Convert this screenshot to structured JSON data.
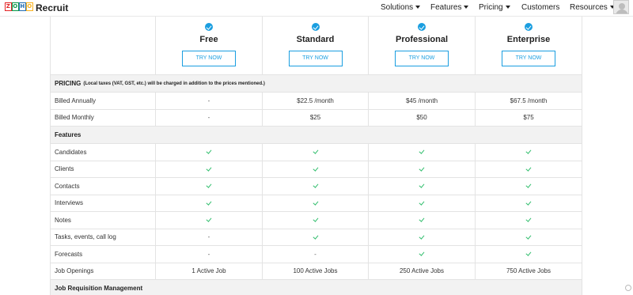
{
  "header": {
    "logo_letters": [
      "Z",
      "O",
      "H",
      "O"
    ],
    "logo_colors": [
      "#e42527",
      "#089949",
      "#226db4",
      "#f9b21d"
    ],
    "brand": "Recruit",
    "nav": [
      {
        "label": "Solutions",
        "has_caret": true
      },
      {
        "label": "Features",
        "has_caret": true
      },
      {
        "label": "Pricing",
        "has_caret": true
      },
      {
        "label": "Customers",
        "has_caret": false
      },
      {
        "label": "Resources",
        "has_caret": true
      }
    ]
  },
  "plans": [
    {
      "name": "Free",
      "cta": "TRY NOW"
    },
    {
      "name": "Standard",
      "cta": "TRY NOW"
    },
    {
      "name": "Professional",
      "cta": "TRY NOW"
    },
    {
      "name": "Enterprise",
      "cta": "TRY NOW"
    }
  ],
  "pricing_section": {
    "title": "PRICING",
    "note": "(Local taxes (VAT, GST, etc.) will be charged in addition to the prices mentioned.)"
  },
  "pricing_rows": [
    {
      "label": "Billed Annually",
      "values": [
        "-",
        "$22.5 /month",
        "$45 /month",
        "$67.5 /month"
      ]
    },
    {
      "label": "Billed Monthly",
      "values": [
        "-",
        "$25",
        "$50",
        "$75"
      ]
    }
  ],
  "features_section": {
    "title": "Features"
  },
  "feature_rows": [
    {
      "label": "Candidates",
      "values": [
        "check",
        "check",
        "check",
        "check"
      ]
    },
    {
      "label": "Clients",
      "values": [
        "check",
        "check",
        "check",
        "check"
      ]
    },
    {
      "label": "Contacts",
      "values": [
        "check",
        "check",
        "check",
        "check"
      ]
    },
    {
      "label": "Interviews",
      "values": [
        "check",
        "check",
        "check",
        "check"
      ]
    },
    {
      "label": "Notes",
      "values": [
        "check",
        "check",
        "check",
        "check"
      ]
    },
    {
      "label": "Tasks, events, call log",
      "values": [
        "-",
        "check",
        "check",
        "check"
      ]
    },
    {
      "label": "Forecasts",
      "values": [
        "-",
        "-",
        "check",
        "check"
      ]
    },
    {
      "label": "Job Openings",
      "values": [
        "1 Active Job",
        "100 Active Jobs",
        "250 Active Jobs",
        "750 Active Jobs"
      ]
    }
  ],
  "next_section": {
    "title": "Job Requisition Management"
  },
  "colors": {
    "accent": "#1a9ee0",
    "check": "#2ebd6b",
    "section_bg": "#f2f2f2"
  }
}
